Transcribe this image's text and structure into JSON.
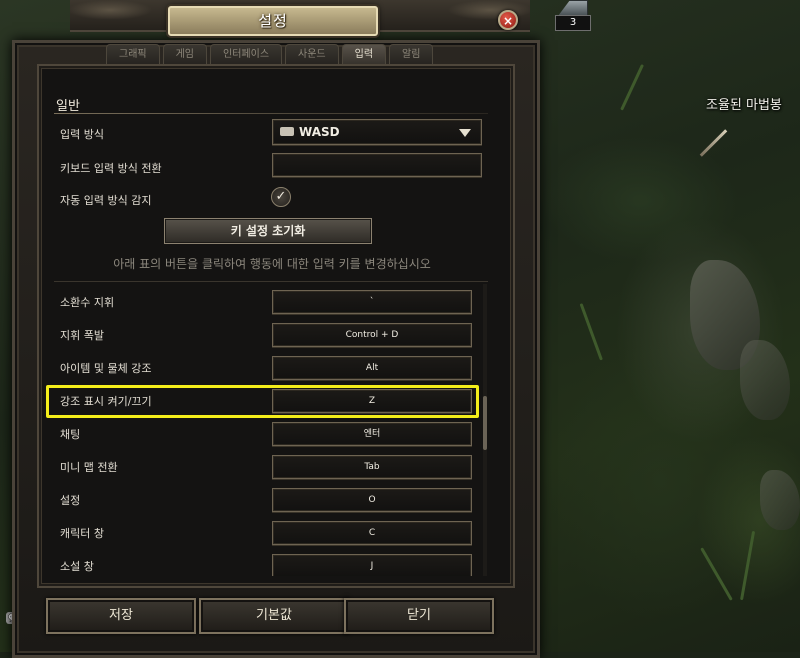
{
  "window": {
    "title": "설정",
    "close_icon": "×"
  },
  "tabs": [
    {
      "label": "그래픽"
    },
    {
      "label": "게임"
    },
    {
      "label": "인터페이스"
    },
    {
      "label": "사운드"
    },
    {
      "label": "입력",
      "active": true
    },
    {
      "label": "알림"
    }
  ],
  "general": {
    "section_title": "일반",
    "input_method_label": "입력 방식",
    "input_method_value": "WASD",
    "input_method_icon": "keyboard-mouse-icon",
    "keyboard_toggle_label": "키보드 입력 방식 전환",
    "keyboard_toggle_value": "",
    "auto_detect_label": "자동 입력 방식 감지",
    "auto_detect_checked": true,
    "check_glyph": "✓",
    "reset_button": "키 설정 초기화",
    "hint": "아래 표의 버튼을 클릭하여 행동에 대한 입력 키를 변경하십시오"
  },
  "keybinds": [
    {
      "label": "소환수 지휘",
      "key": "`"
    },
    {
      "label": "지휘 폭발",
      "key": "Control + D"
    },
    {
      "label": "아이템 및 물체 강조",
      "key": "Alt"
    },
    {
      "label": "강조 표시 켜기/끄기",
      "key": "Z",
      "highlighted": true
    },
    {
      "label": "채팅",
      "key": "엔터"
    },
    {
      "label": "미니 맵 전환",
      "key": "Tab"
    },
    {
      "label": "설정",
      "key": "O"
    },
    {
      "label": "캐릭터 창",
      "key": "C"
    },
    {
      "label": "소설 창",
      "key": "J"
    }
  ],
  "buttons": {
    "save": "저장",
    "defaults": "기본값",
    "close": "닫기"
  },
  "world": {
    "item_label": "조율된 마법봉",
    "stack_count": "3",
    "chat_icon": "chat-bubble-icon"
  },
  "colors": {
    "highlight": "#f4ee1a",
    "title_plate": "#c6b88f",
    "close_button": "#c03a2b"
  }
}
